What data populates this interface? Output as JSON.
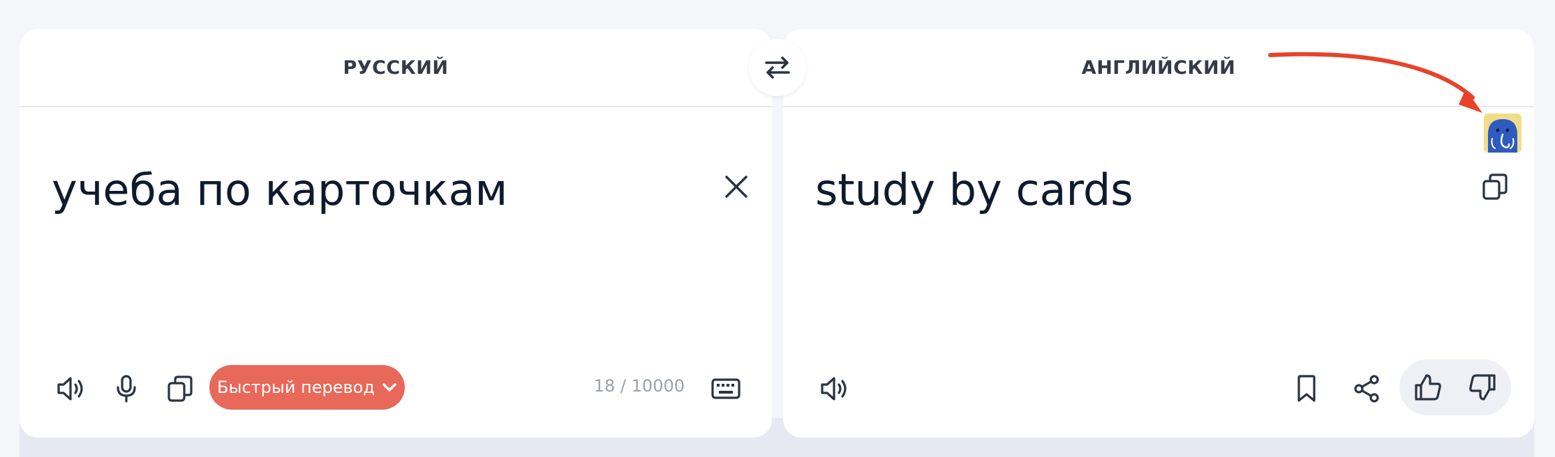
{
  "colors": {
    "page_bg": "#f5f6fa",
    "panel_bg": "#ffffff",
    "accent": "#e8685a",
    "text": "#0f1a2e",
    "arrow": "#e8432a"
  },
  "source": {
    "language": "РУССКИЙ",
    "text": "учеба по карточкам",
    "counter": "18 / 10000",
    "quick_translate_label": "Быстрый перевод",
    "icons": [
      "close-icon",
      "speaker-icon",
      "microphone-icon",
      "copy-icon",
      "chevron-down-icon",
      "keyboard-icon"
    ]
  },
  "swap": {
    "icon": "swap-arrows-icon"
  },
  "target": {
    "language": "АНГЛИЙСКИЙ",
    "text": "study by cards",
    "icons": [
      "copy-icon",
      "speaker-icon",
      "bookmark-icon",
      "share-icon",
      "thumbs-up-icon",
      "thumbs-down-icon"
    ]
  },
  "annotation": {
    "arrow_icon": "red-arrow-annotation",
    "badge_icon": "mammoth-extension-icon"
  }
}
